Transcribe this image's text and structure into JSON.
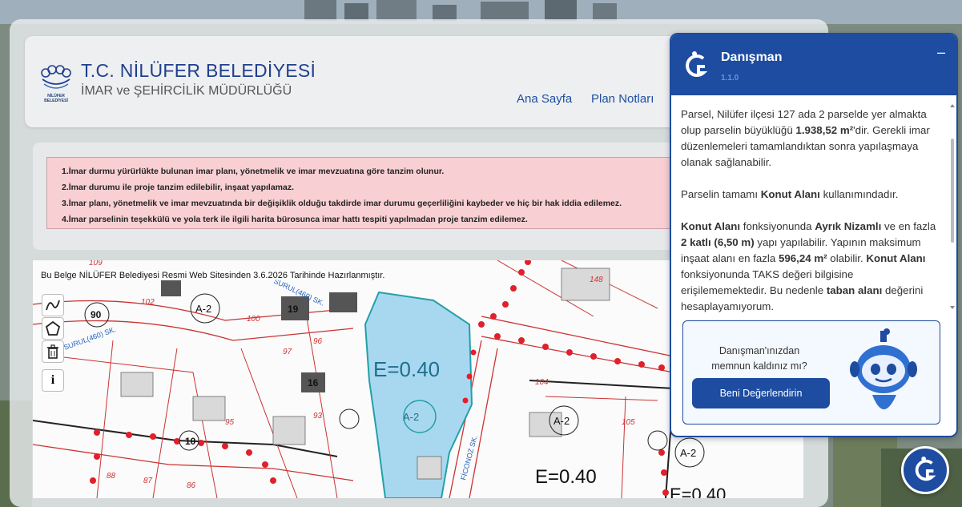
{
  "header": {
    "org_title": "T.C. NİLÜFER BELEDİYESİ",
    "department": "İMAR ve ŞEHİRCİLİK MÜDÜRLÜĞÜ",
    "logo_text_1": "NİLÜFER",
    "logo_text_2": "BELEDİYESİ",
    "nav": [
      {
        "label": "Ana Sayfa"
      },
      {
        "label": "Plan Notları"
      }
    ]
  },
  "notes": [
    "1.İmar durmu yürürlükte bulunan imar planı, yönetmelik ve imar mevzuatına göre tanzim olunur.",
    "2.İmar durumu ile proje tanzim edilebilir, inşaat yapılamaz.",
    "3.İmar planı, yönetmelik ve imar mevzuatında bir değişiklik olduğu takdirde imar durumu geçerliliğini kaybeder ve hiç bir hak iddia edilemez.",
    "4.İmar parselinin teşekkülü ve yola terk ile ilgili harita bürosunca imar hattı tespiti yapılmadan proje tanzim edilemez."
  ],
  "map": {
    "caption": "Bu Belge NİLÜFER Belediyesi Resmi Web Sitesinden 3.6.2026 Tarihinde Hazırlanmıştır.",
    "labels": {
      "e_main": "E=0.40",
      "e_right": "E=0.40",
      "e_edge": "E=0.40",
      "a2_1": "A-2",
      "a2_2": "A-2",
      "a2_3": "A-2",
      "a2_4": "A-2",
      "street_1": "SURUL(460) SK.",
      "street_2": "SURUL(460) SK.",
      "street_3": "FİCONOZ SK.",
      "parcel_104": "104",
      "parcel_105": "105",
      "parcel_148": "148",
      "parcel_95": "95",
      "parcel_93": "93",
      "parcel_97": "97",
      "parcel_96": "96",
      "parcel_100": "100",
      "parcel_102": "102",
      "parcel_88": "88",
      "parcel_87": "87",
      "parcel_86": "86",
      "parcel_19": "19",
      "parcel_16": "16",
      "parcel_10": "10",
      "parcel_90": "90",
      "parcel_109": "109"
    }
  },
  "chat": {
    "title": "Danışman",
    "version": "1.1.0",
    "minimize": "–",
    "p1_a": "Parsel, Nilüfer ilçesi 127 ada 2 parselde yer almakta olup parselin büyüklüğü ",
    "p1_b": "1.938,52 m²",
    "p1_c": "'dir. Gerekli imar düzenlemeleri tamamlandıktan sonra yapılaşmaya olanak sağlanabilir.",
    "p2_a": "Parselin tamamı ",
    "p2_b": "Konut Alanı",
    "p2_c": " kullanımındadır.",
    "p3_a": "Konut Alanı",
    "p3_b": " fonksiyonunda ",
    "p3_c": "Ayrık Nizamlı",
    "p3_d": " ve en fazla ",
    "p3_e": "2 katlı (6,50 m)",
    "p3_f": " yapı yapılabilir. Yapının maksimum inşaat alanı en fazla ",
    "p3_g": "596,24 m²",
    "p3_h": " olabilir. ",
    "p3_i": "Konut Alanı",
    "p3_j": " fonksiyonunda TAKS değeri bilgisine erişilememektedir. Bu nedenle ",
    "p3_k": "taban alanı",
    "p3_l": " değerini hesaplayamıyorum.",
    "rate_question": "Danışman'ınızdan memnun kaldınız mı?",
    "rate_button": "Beni Değerlendirin"
  },
  "tools": {
    "info_glyph": "i"
  },
  "colors": {
    "brand_blue": "#1d4ca0",
    "notes_bg": "#f8cfd2",
    "zone_fill": "#a8d8f0",
    "road_red": "#e0202a"
  }
}
